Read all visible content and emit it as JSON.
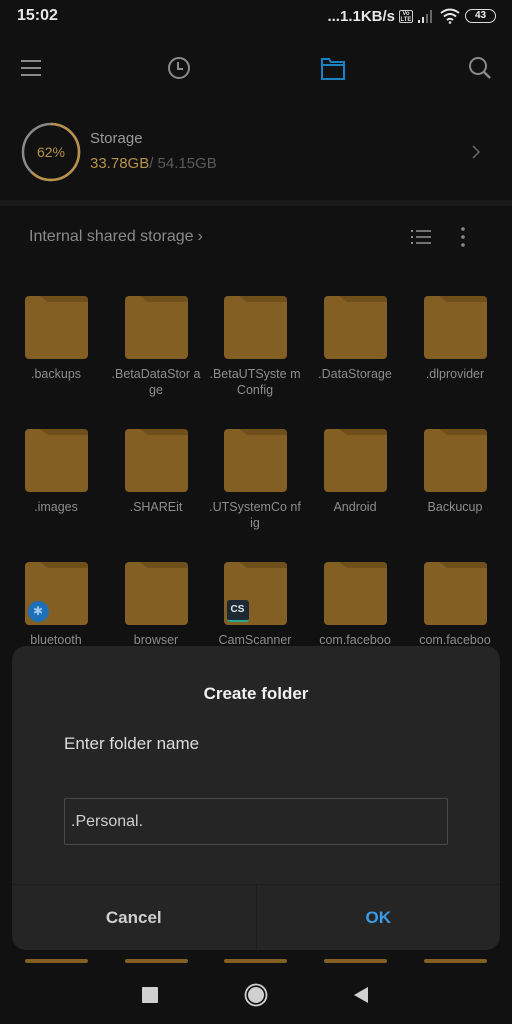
{
  "status_bar": {
    "time": "15:02",
    "network_speed": "...1.1KB/s",
    "volte_label": "Vo LTE",
    "battery": "43"
  },
  "toolbar": {
    "icons": [
      "menu-icon",
      "recent-icon",
      "folder-icon",
      "search-icon"
    ],
    "active": "folder-icon",
    "accent_color": "#1d7fc4"
  },
  "storage": {
    "title": "Storage",
    "percent_label": "62%",
    "percent_value": 0.62,
    "used": "33.78GB",
    "total": "/ 54.15GB",
    "ring_color": "#b8914a"
  },
  "path": {
    "label": "Internal shared storage",
    "chevron": "›"
  },
  "folders": [
    {
      "name": ".backups"
    },
    {
      "name": ".BetaDataStor age"
    },
    {
      "name": ".BetaUTSyste mConfig"
    },
    {
      "name": ".DataStorage"
    },
    {
      "name": ".dlprovider"
    },
    {
      "name": ".images"
    },
    {
      "name": ".SHAREit"
    },
    {
      "name": ".UTSystemCo nfig"
    },
    {
      "name": "Android"
    },
    {
      "name": "Backucup"
    },
    {
      "name": "bluetooth",
      "badge": "bluetooth"
    },
    {
      "name": "browser"
    },
    {
      "name": "CamScanner",
      "badge": "CS"
    },
    {
      "name": "com.faceboo"
    },
    {
      "name": "com.faceboo"
    }
  ],
  "dialog": {
    "title": "Create folder",
    "label": "Enter folder name",
    "input_value": ".Personal.",
    "cancel_label": "Cancel",
    "ok_label": "OK",
    "ok_color": "#3a9be6"
  },
  "nav": {
    "recents": "recents-icon",
    "home": "home-icon",
    "back": "back-icon"
  }
}
